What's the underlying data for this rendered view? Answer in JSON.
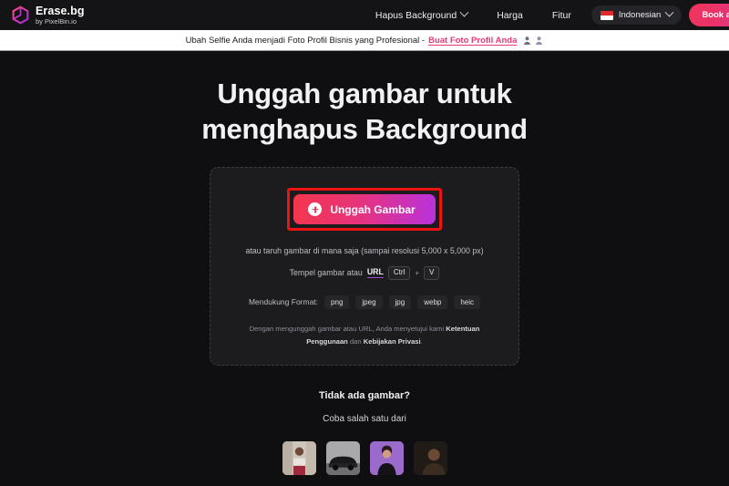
{
  "header": {
    "brand_name": "Erase.bg",
    "brand_sub": "by PixelBin.io",
    "logo_icon": "erasebg-cube-logo",
    "nav": [
      {
        "label": "Hapus Background",
        "has_dropdown": true,
        "icon": "chevron-down-icon"
      },
      {
        "label": "Harga",
        "has_dropdown": false
      },
      {
        "label": "Fitur",
        "has_dropdown": false
      }
    ],
    "language": {
      "label": "Indonesian",
      "flag_icon": "indonesia-flag-icon",
      "chevron_icon": "chevron-down-icon"
    },
    "cta": {
      "label": "Book a",
      "color": "#e8336c"
    }
  },
  "banner": {
    "text": "Ubah Selfie Anda menjadi Foto Profil Bisnis yang Profesional -",
    "link": "Buat Foto Profil Anda",
    "link_color": "#e63a7a",
    "icons": [
      "avatar-person-icon",
      "avatar-person-icon"
    ]
  },
  "main": {
    "title_line1": "Unggah gambar untuk",
    "title_line2": "menghapus Background",
    "upload_button": {
      "label": "Unggah Gambar",
      "icon": "plus-circle-icon",
      "highlight_color": "#ee1111",
      "gradient_from": "#f4364c",
      "gradient_to": "#b832dd"
    },
    "drop_hint": "atau taruh gambar di mana saja (sampai resolusi 5,000 x 5,000 px)",
    "paste": {
      "text": "Tempel gambar atau",
      "url_label": "URL",
      "key_ctrl": "Ctrl",
      "key_plus": "+",
      "key_v": "V"
    },
    "formats": {
      "label": "Mendukung Format:",
      "items": [
        "png",
        "jpeg",
        "jpg",
        "webp",
        "heic"
      ]
    },
    "terms": {
      "part1": "Dengan mengunggah gambar atau URL, Anda menyetujui kami",
      "bold1": "Ketentuan Penggunaan",
      "middle": "dan",
      "bold2": "Kebijakan Privasi",
      "period": "."
    }
  },
  "samples": {
    "title": "Tidak ada gambar?",
    "subtitle": "Coba salah satu dari",
    "thumbnails": [
      {
        "name": "sample-thumbnail-street-portrait"
      },
      {
        "name": "sample-thumbnail-car"
      },
      {
        "name": "sample-thumbnail-woman-purple"
      },
      {
        "name": "sample-thumbnail-dark-portrait"
      }
    ]
  }
}
